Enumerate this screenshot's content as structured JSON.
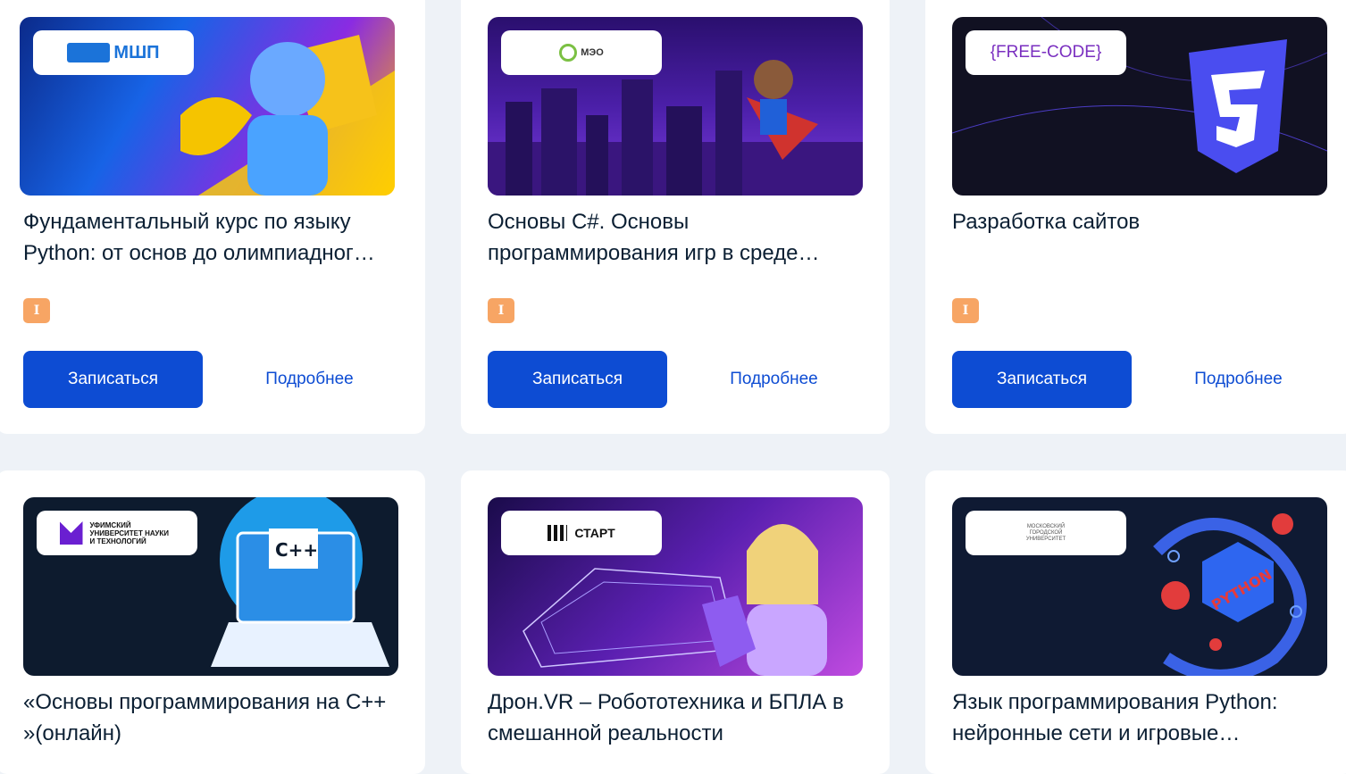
{
  "cards": [
    {
      "logo": "МШП",
      "title": "Фундаментальный курс по языку Python: от основ до олимпиадног…",
      "badge": "I",
      "enroll": "Записаться",
      "details": "Подробнее"
    },
    {
      "logo": "МЭО",
      "title": "Основы С#. Основы программирования игр в среде…",
      "badge": "I",
      "enroll": "Записаться",
      "details": "Подробнее"
    },
    {
      "logo": "{FREE-CODE}",
      "title": "Разработка сайтов",
      "badge": "I",
      "enroll": "Записаться",
      "details": "Подробнее"
    },
    {
      "logo": "УФИМСКИЙ УНИВЕРСИТЕТ НАУКИ И ТЕХНОЛОГИЙ",
      "title": "«Основы программирования на С++ »(онлайн)"
    },
    {
      "logo": "СТАРТ",
      "title": "Дрон.VR – Робототехника и БПЛА в смешанной реальности"
    },
    {
      "logo": "МОСКОВСКИЙ ГОРОДСКОЙ УНИВЕРСИТЕТ",
      "title": "Язык программирования Python: нейронные сети и игровые…"
    }
  ],
  "banner_art": {
    "c_plus_plus": "C++",
    "python": "PYTHON"
  }
}
